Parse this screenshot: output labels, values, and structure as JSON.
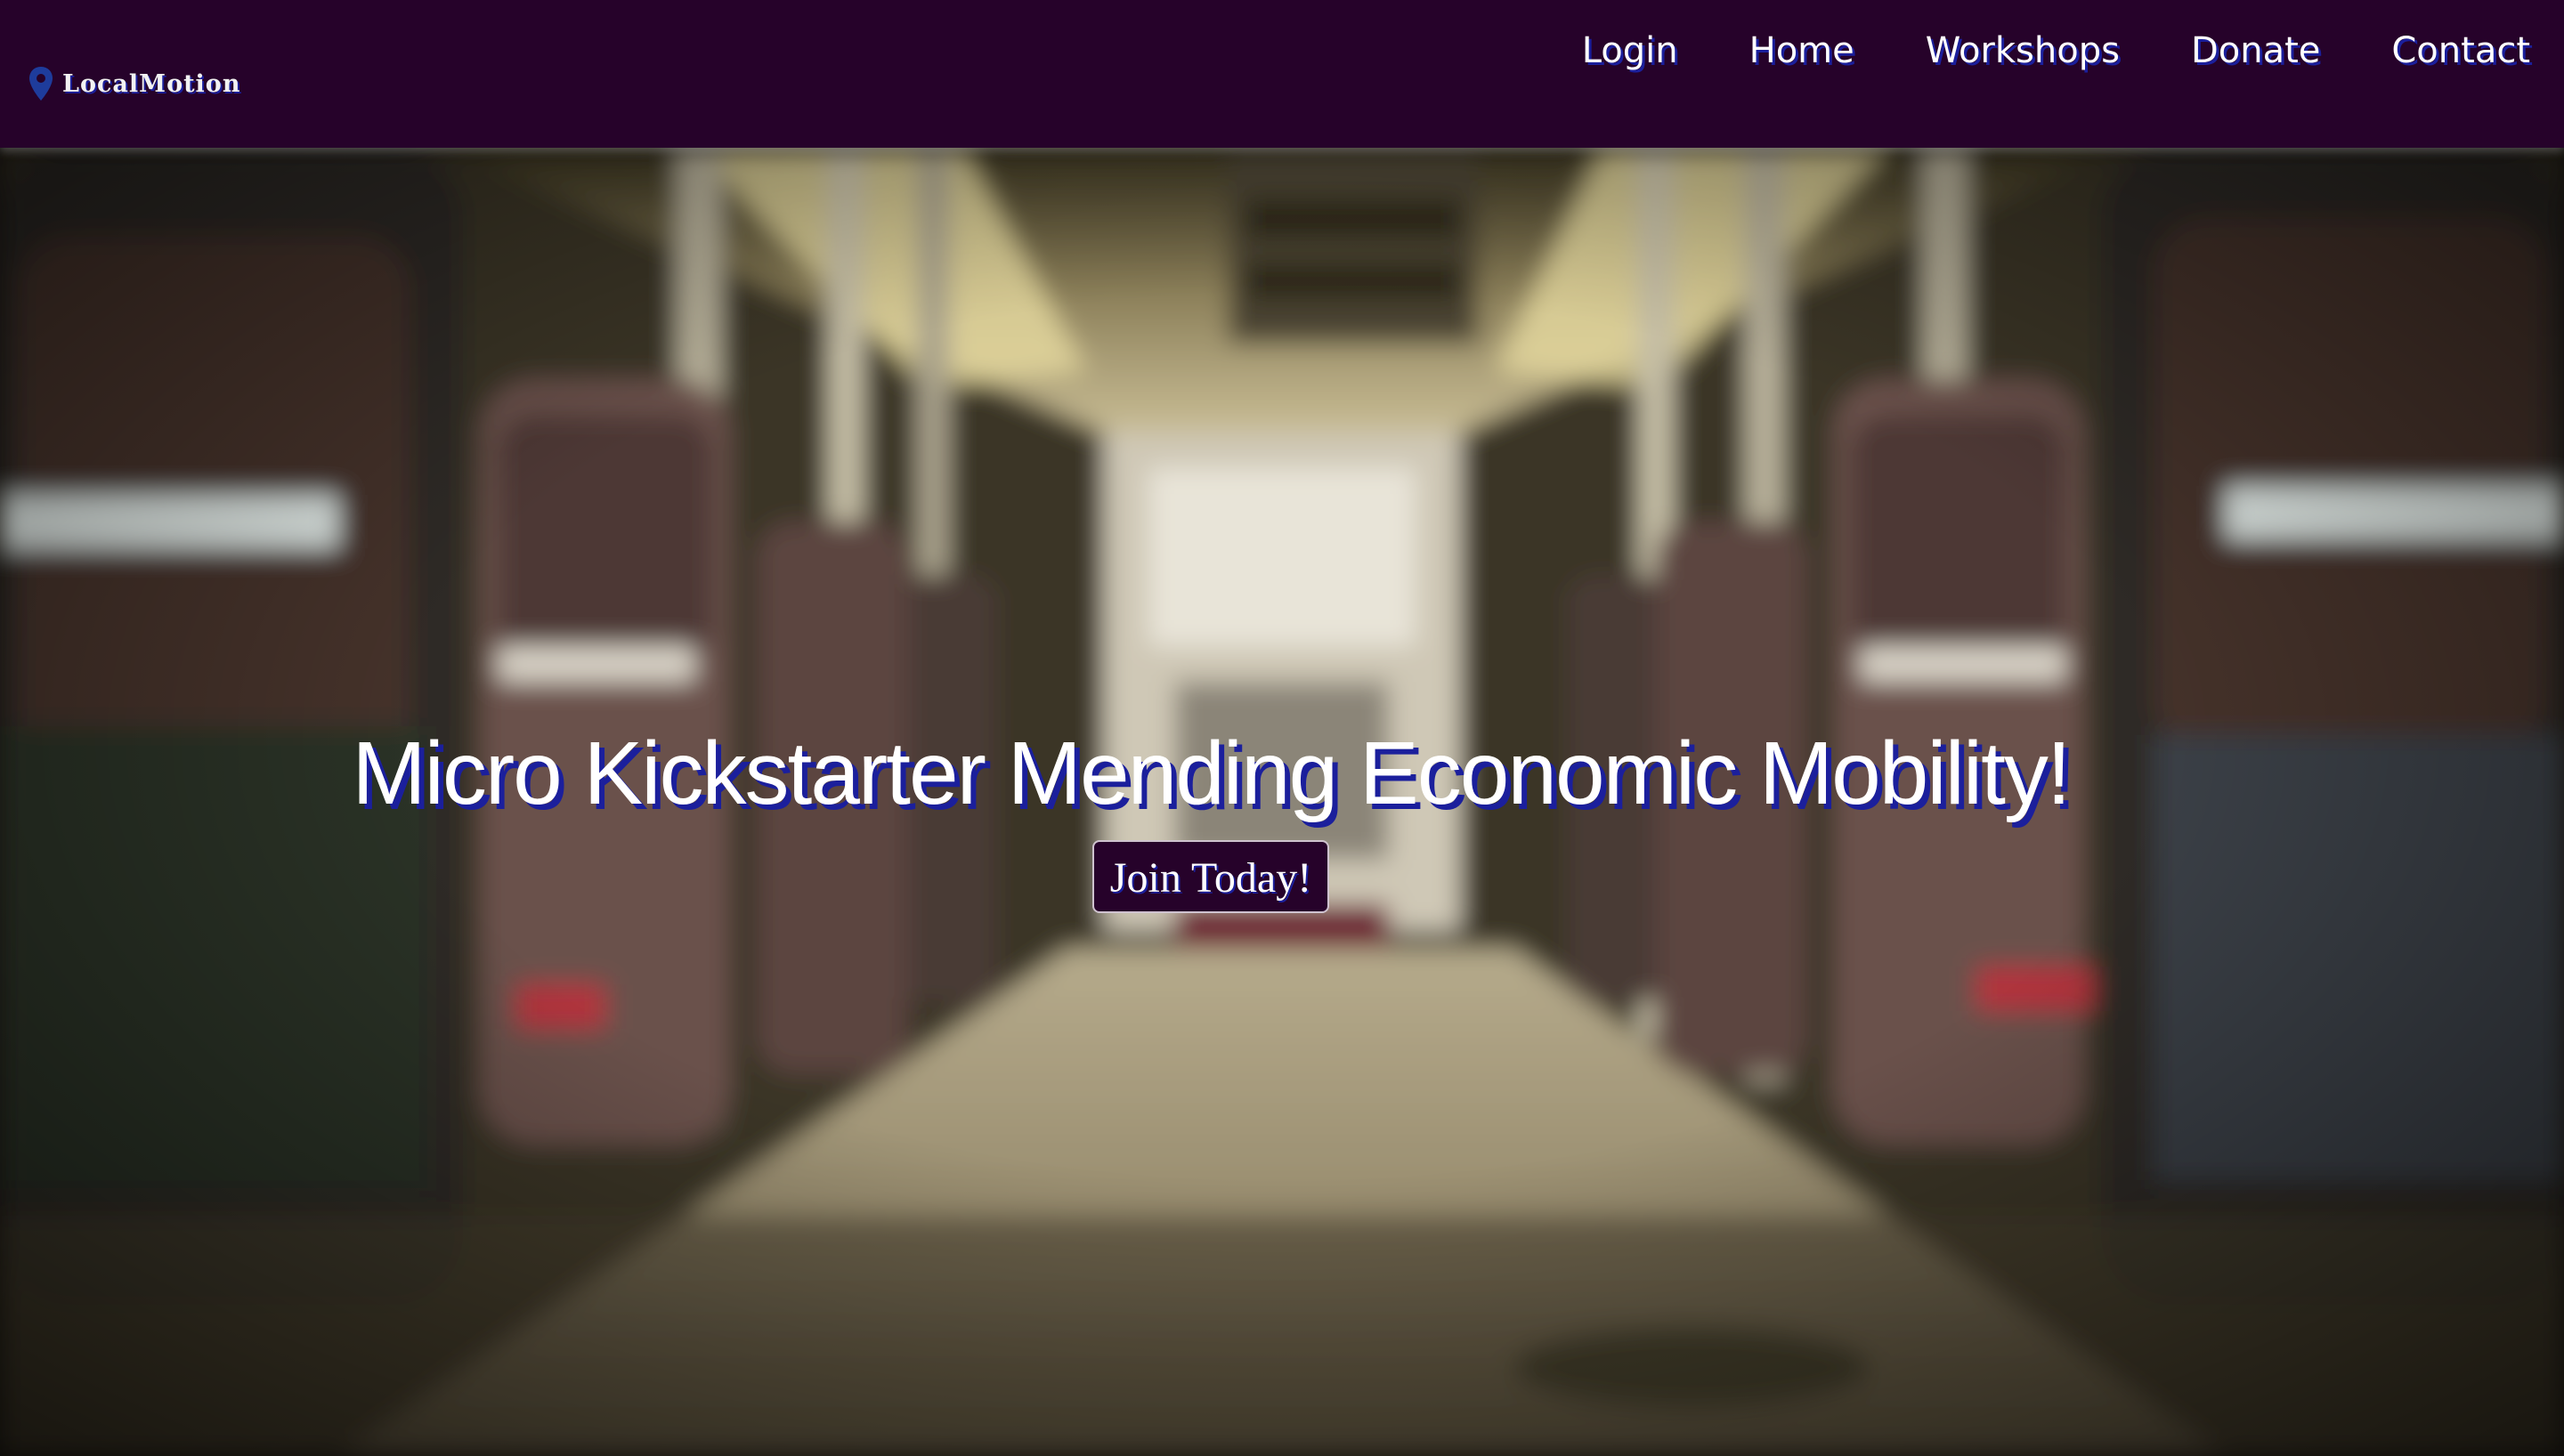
{
  "brand": {
    "name": "LocalMotion",
    "icon": "map-pin-icon"
  },
  "nav": {
    "links": [
      {
        "label": "Login"
      },
      {
        "label": "Home"
      },
      {
        "label": "Workshops"
      },
      {
        "label": "Donate"
      },
      {
        "label": "Contact"
      }
    ]
  },
  "hero": {
    "title": "Micro Kickstarter Mending Economic Mobility!",
    "cta_label": "Join Today!",
    "background": "blurred-bus-interior-photo"
  },
  "colors": {
    "navbar_bg": "#26022a",
    "text_shadow": "#1b1f9c",
    "pin_blue": "#1e3c9c",
    "button_bg": "#26022a"
  }
}
